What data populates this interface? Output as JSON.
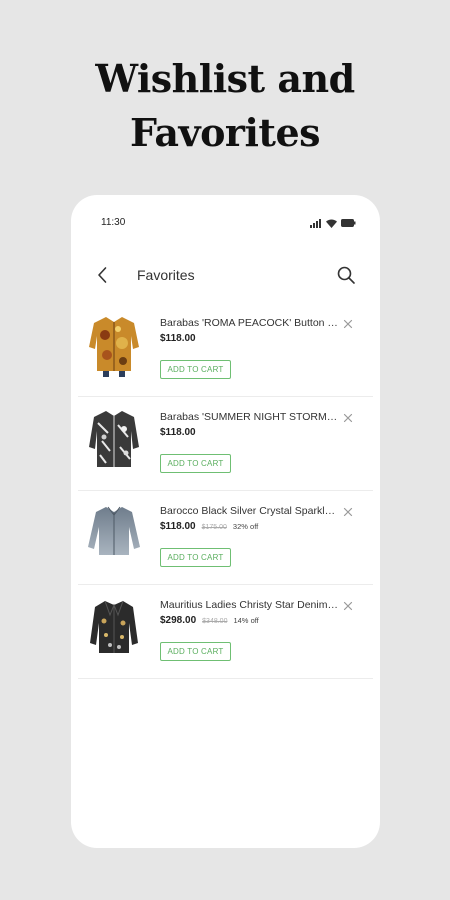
{
  "headline": {
    "line1": "Wishlist and",
    "line2": "Favorites"
  },
  "status_bar": {
    "time": "11:30",
    "icons": [
      "signal-icon",
      "wifi-icon",
      "battery-icon"
    ]
  },
  "app_bar": {
    "title": "Favorites",
    "back_icon": "chevron-left-icon",
    "search_icon": "search-icon"
  },
  "items": [
    {
      "name": "Barabas 'ROMA PEACOCK' Button Down Shirt",
      "price": "$118.00",
      "old_price": "",
      "discount": "",
      "cta": "ADD TO CART",
      "image": "orange-paisley-shirt"
    },
    {
      "name": "Barabas 'SUMMER NIGHT STORM' Shirt",
      "price": "$118.00",
      "old_price": "",
      "discount": "",
      "cta": "ADD TO CART",
      "image": "black-white-patterned-shirt"
    },
    {
      "name": "Barocco Black Silver Crystal Sparkle Shirt",
      "price": "$118.00",
      "old_price": "$175.00",
      "discount": "32% off",
      "cta": "ADD TO CART",
      "image": "grey-silver-shirt"
    },
    {
      "name": "Mauritius Ladies Christy Star Denim Jacket",
      "price": "$298.00",
      "old_price": "$348.00",
      "discount": "14% off",
      "cta": "ADD TO CART",
      "image": "black-studded-jacket"
    }
  ],
  "colors": {
    "background": "#e6e6e6",
    "card": "#ffffff",
    "accent_green": "#5aae5e",
    "text": "#333333"
  }
}
